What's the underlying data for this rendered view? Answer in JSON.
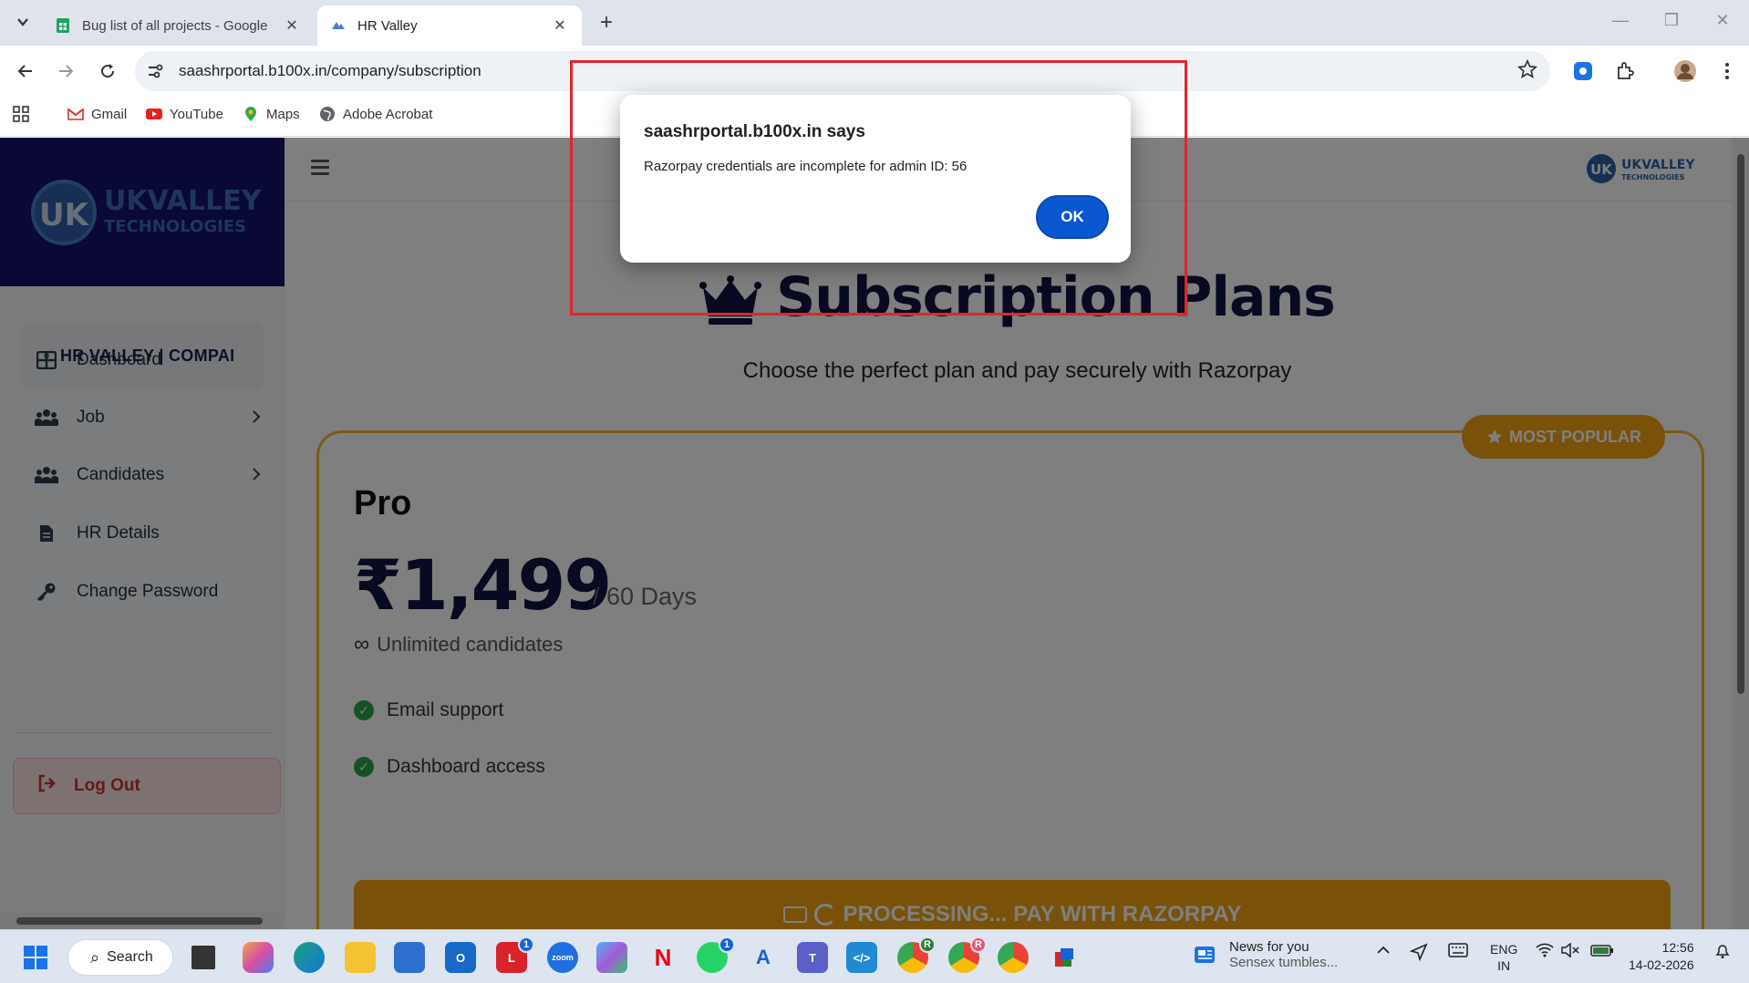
{
  "browser": {
    "tabs": [
      {
        "title": "Bug list of all projects - Google",
        "active": false
      },
      {
        "title": "HR Valley",
        "active": true
      }
    ],
    "url": "saashrportal.b100x.in/company/subscription",
    "bookmarks": [
      "Gmail",
      "YouTube",
      "Maps",
      "Adobe Acrobat"
    ]
  },
  "brand": {
    "name_line1": "UKVALLEY",
    "name_line2": "TECHNOLOGIES"
  },
  "sidebar": {
    "company": "HR VALLEY | COMPAI",
    "items": [
      {
        "label": "Dashboard",
        "icon": "grid-icon",
        "has_submenu": false
      },
      {
        "label": "Job",
        "icon": "users-icon",
        "has_submenu": true
      },
      {
        "label": "Candidates",
        "icon": "users-icon",
        "has_submenu": true
      },
      {
        "label": "HR Details",
        "icon": "document-icon",
        "has_submenu": false
      },
      {
        "label": "Change Password",
        "icon": "key-icon",
        "has_submenu": false
      }
    ],
    "logout": "Log Out"
  },
  "main": {
    "title": "Subscription Plans",
    "subtitle": "Choose the perfect plan and pay securely with Razorpay",
    "plan": {
      "badge": "MOST POPULAR",
      "name": "Pro",
      "price": "₹1,499",
      "period": "/ 60 Days",
      "candidates": "Unlimited candidates",
      "features": [
        "Email support",
        "Dashboard access"
      ],
      "pay_button": "PROCESSING... PAY WITH RAZORPAY"
    }
  },
  "dialog": {
    "title": "saashrportal.b100x.in says",
    "message": "Razorpay credentials are incomplete for admin ID: 56",
    "ok": "OK"
  },
  "taskbar": {
    "search": "Search",
    "news_title": "News for you",
    "news_sub": "Sensex tumbles...",
    "lang_line1": "ENG",
    "lang_line2": "IN",
    "time": "12:56",
    "date": "14-02-2026",
    "badges": {
      "lens": "1",
      "whatsapp": "1",
      "chrome1": "R",
      "chrome2": "R"
    }
  },
  "colors": {
    "accent": "#f4a312",
    "navy": "#0f1440",
    "brand_blue": "#0b57d0",
    "highlight_red": "#e0262b"
  }
}
